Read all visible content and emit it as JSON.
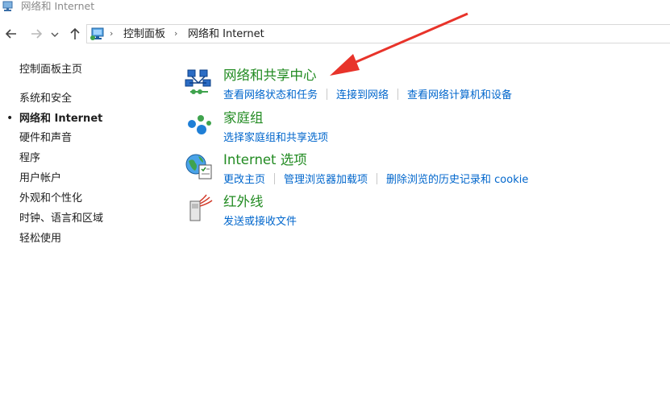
{
  "window": {
    "title": "网络和 Internet"
  },
  "breadcrumb": {
    "items": [
      "控制面板",
      "网络和 Internet"
    ]
  },
  "sidebar": {
    "items": [
      {
        "label": "控制面板主页"
      },
      {
        "label": "系统和安全"
      },
      {
        "label": "网络和 Internet",
        "current": true
      },
      {
        "label": "硬件和声音"
      },
      {
        "label": "程序"
      },
      {
        "label": "用户帐户"
      },
      {
        "label": "外观和个性化"
      },
      {
        "label": "时钟、语言和区域"
      },
      {
        "label": "轻松使用"
      }
    ]
  },
  "categories": [
    {
      "title": "网络和共享中心",
      "icon": "network-sharing-center-icon",
      "links": [
        "查看网络状态和任务",
        "连接到网络",
        "查看网络计算机和设备"
      ]
    },
    {
      "title": "家庭组",
      "icon": "homegroup-icon",
      "links": [
        "选择家庭组和共享选项"
      ]
    },
    {
      "title": "Internet 选项",
      "icon": "internet-options-icon",
      "links": [
        "更改主页",
        "管理浏览器加载项",
        "删除浏览的历史记录和 cookie"
      ]
    },
    {
      "title": "红外线",
      "icon": "infrared-icon",
      "links": [
        "发送或接收文件"
      ]
    }
  ],
  "colors": {
    "category_title": "#228b22",
    "link": "#0066cc",
    "annotation_arrow": "#e8332a"
  }
}
